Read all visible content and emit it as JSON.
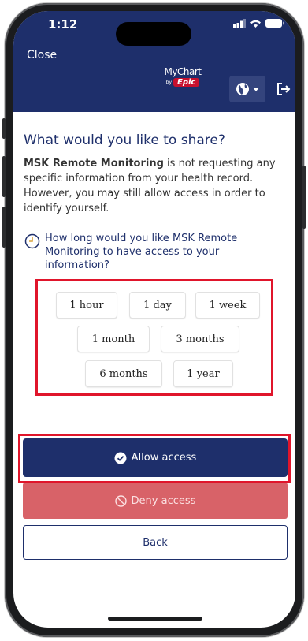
{
  "status_bar": {
    "time": "1:12"
  },
  "header": {
    "close_label": "Close",
    "logo_top": "MyChart",
    "logo_by": "by",
    "logo_epic": "Epic",
    "globe_icon": "globe-icon",
    "exit_icon": "exit-icon"
  },
  "main": {
    "title": "What would you like to share?",
    "desc_bold": "MSK Remote Monitoring",
    "desc_rest": " is not requesting any specific information from your health record. However, you may still allow access in order to identify yourself.",
    "question": "How long would you like MSK Remote Monitoring to have access to your information?",
    "durations": [
      "1 hour",
      "1 day",
      "1 week",
      "1 month",
      "3 months",
      "6 months",
      "1 year"
    ]
  },
  "actions": {
    "allow_label": "Allow access",
    "deny_label": "Deny access",
    "back_label": "Back"
  },
  "colors": {
    "brand_navy": "#1e2f6b",
    "highlight_red": "#e0152b",
    "deny_red": "#d86268",
    "epic_red": "#c8102e"
  }
}
